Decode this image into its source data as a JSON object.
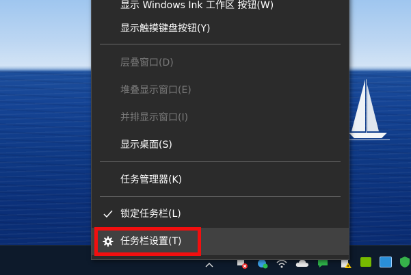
{
  "menu": {
    "items": [
      {
        "label": "显示 Windows Ink 工作区 按钮(W)",
        "state": "normal"
      },
      {
        "label": "显示触摸键盘按钮(Y)",
        "state": "normal"
      },
      {
        "label": "层叠窗口(D)",
        "state": "disabled"
      },
      {
        "label": "堆叠显示窗口(E)",
        "state": "disabled"
      },
      {
        "label": "并排显示窗口(I)",
        "state": "disabled"
      },
      {
        "label": "显示桌面(S)",
        "state": "normal"
      },
      {
        "label": "任务管理器(K)",
        "state": "normal"
      },
      {
        "label": "锁定任务栏(L)",
        "state": "checked"
      },
      {
        "label": "任务栏设置(T)",
        "state": "hovered",
        "icon": "gear-icon"
      }
    ]
  },
  "taskbar": {
    "tray_icons": [
      "show-hidden-icons-arrow",
      "network-error-icon",
      "app-icon",
      "wifi-icon",
      "cloud-icon",
      "chat-icon",
      "warning-icon",
      "nvidia-icon",
      "monitor-icon",
      "shield-icon"
    ]
  },
  "colors": {
    "menu_bg": "#2b2b2b",
    "menu_hover": "#414141",
    "disabled_text": "#7a7a7a",
    "highlight": "#f20f0f",
    "taskbar_bg": "#0d1a2b"
  }
}
